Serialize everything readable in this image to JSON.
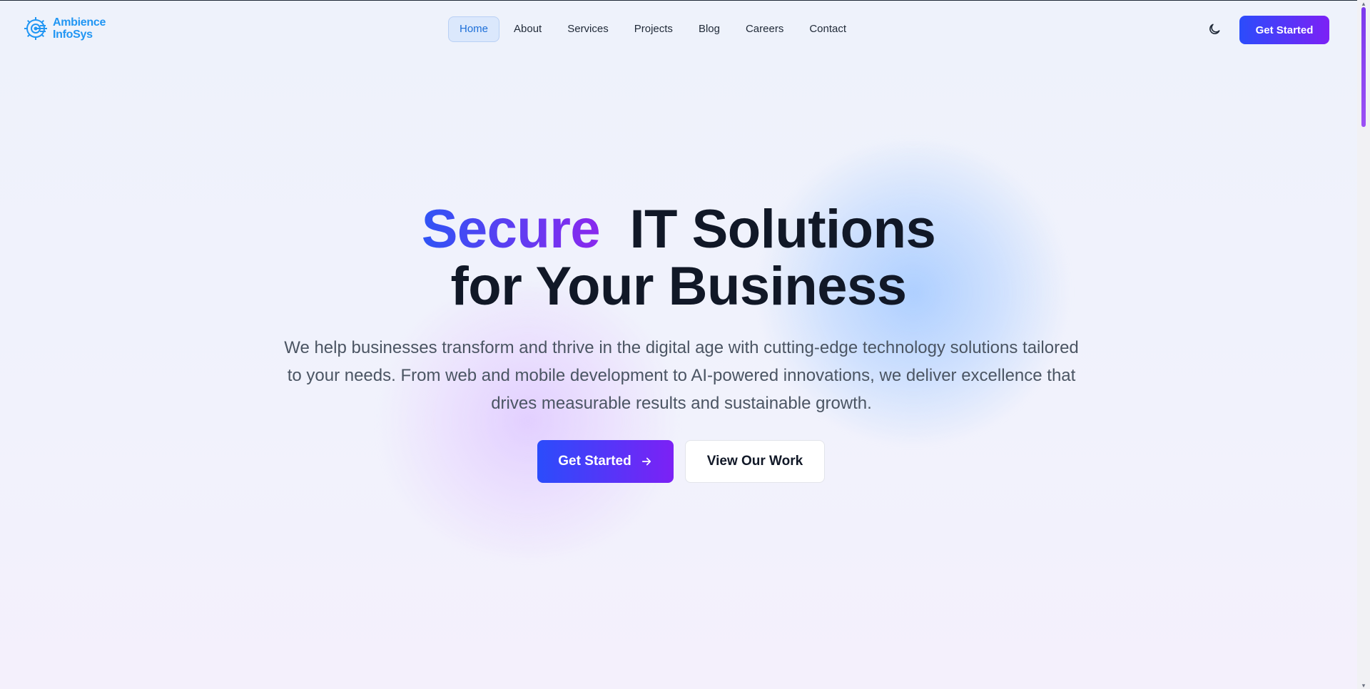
{
  "brand": {
    "line1": "Ambience",
    "line2": "InfoSys",
    "logo_icon": "gear-circuit-icon",
    "color": "#2196f3"
  },
  "nav": {
    "items": [
      {
        "label": "Home",
        "active": true
      },
      {
        "label": "About",
        "active": false
      },
      {
        "label": "Services",
        "active": false
      },
      {
        "label": "Projects",
        "active": false
      },
      {
        "label": "Blog",
        "active": false
      },
      {
        "label": "Careers",
        "active": false
      },
      {
        "label": "Contact",
        "active": false
      }
    ],
    "theme_toggle_icon": "moon-icon",
    "cta_label": "Get Started"
  },
  "hero": {
    "title_highlight": "Secure",
    "title_rest": "IT Solutions",
    "title_line2": "for Your Business",
    "subtitle": "We help businesses transform and thrive in the digital age with cutting-edge technology solutions tailored to your needs. From web and mobile development to AI-powered innovations, we deliver excellence that drives measurable results and sustainable growth.",
    "primary_cta": "Get Started",
    "primary_cta_icon": "arrow-right-icon",
    "secondary_cta": "View Our Work"
  },
  "colors": {
    "gradient_start": "#2b4cfb",
    "gradient_end": "#7c21f5",
    "active_nav_bg": "#dbe8fc",
    "active_nav_text": "#1d6fd8"
  }
}
